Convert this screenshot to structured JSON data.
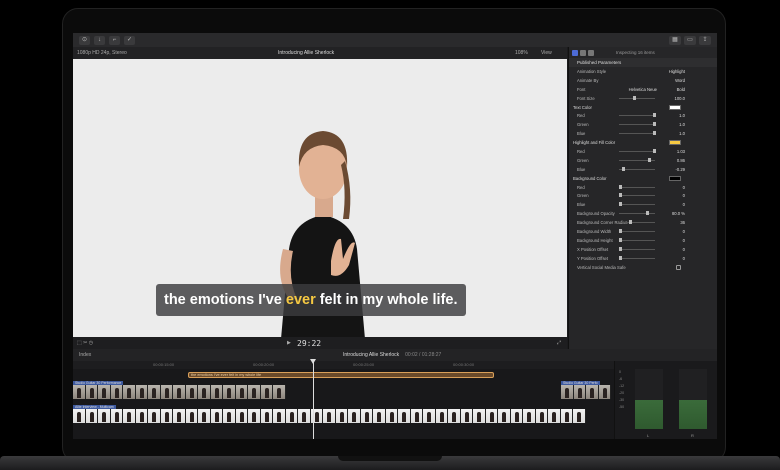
{
  "viewer": {
    "format": "1080p HD 24p, Stereo",
    "title": "Introducing Allie Sherlock",
    "zoom": "108%",
    "view_menu": "View",
    "timecode": "29:22",
    "caption_before": "the emotions I've",
    "caption_highlight": "ever",
    "caption_after": "felt in my whole life."
  },
  "inspector": {
    "selection": "Inspecting 16 items",
    "section_title": "Published Parameters",
    "rows": [
      {
        "label": "Animation Style",
        "value": "Highlight",
        "type": "popup"
      },
      {
        "label": "Animate By",
        "value": "Word",
        "type": "popup"
      },
      {
        "label": "Font",
        "value": "Helvetica Neue",
        "value2": "Bold",
        "type": "font"
      },
      {
        "label": "Font Size",
        "value": "100.0",
        "type": "slider",
        "pos": 0.4
      },
      {
        "label": "Text Color",
        "value": "",
        "type": "color",
        "color": "#ffffff",
        "sec": true
      },
      {
        "label": "Red",
        "value": "1.0",
        "type": "slider",
        "pos": 1.0
      },
      {
        "label": "Green",
        "value": "1.0",
        "type": "slider",
        "pos": 1.0
      },
      {
        "label": "Blue",
        "value": "1.0",
        "type": "slider",
        "pos": 1.0
      },
      {
        "label": "Highlight and Fill Color",
        "value": "",
        "type": "color",
        "color": "#f5c842",
        "sec": true
      },
      {
        "label": "Red",
        "value": "1.03",
        "type": "slider",
        "pos": 1.0
      },
      {
        "label": "Green",
        "value": "0.86",
        "type": "slider",
        "pos": 0.85
      },
      {
        "label": "Blue",
        "value": "-0.29",
        "type": "slider",
        "pos": 0.1
      },
      {
        "label": "Background Color",
        "value": "",
        "type": "color",
        "color": "#000000",
        "sec": true
      },
      {
        "label": "Red",
        "value": "0",
        "type": "slider",
        "pos": 0.0
      },
      {
        "label": "Green",
        "value": "0",
        "type": "slider",
        "pos": 0.0
      },
      {
        "label": "Blue",
        "value": "0",
        "type": "slider",
        "pos": 0.0
      },
      {
        "label": "Background Opacity",
        "value": "80.0 %",
        "type": "slider",
        "pos": 0.8
      },
      {
        "label": "Background Corner Radius",
        "value": "36",
        "type": "slider",
        "pos": 0.3
      },
      {
        "label": "Background Width",
        "value": "0",
        "type": "slider",
        "pos": 0.0
      },
      {
        "label": "Background Height",
        "value": "0",
        "type": "slider",
        "pos": 0.0
      },
      {
        "label": "X Position Offset",
        "value": "0",
        "type": "slider",
        "pos": 0.0
      },
      {
        "label": "Y Position Offset",
        "value": "0",
        "type": "slider",
        "pos": 0.0
      },
      {
        "label": "Vertical Social Media Safe",
        "value": "",
        "type": "checkbox"
      }
    ]
  },
  "timeline": {
    "index_label": "Index",
    "project": "Introducing Allie Sherlock",
    "duration": "00:02 / 01:28:27",
    "caption_clip": "the emotions I've ever felt in my whole life",
    "clip_upper_left": "Studio Guitar 30 Performance",
    "clip_upper_right": "Studio Guitar 30 Perfo",
    "clip_main": "Allie Interview - Multicam",
    "ruler": [
      "00:00:15:00",
      "00:00:20:00",
      "00:00:25:00",
      "00:00:30:00"
    ]
  },
  "meters": {
    "scale": [
      "0",
      "-6",
      "-12",
      "-20",
      "-30",
      "-50"
    ],
    "left": "L",
    "right": "R",
    "level": 0.48
  }
}
